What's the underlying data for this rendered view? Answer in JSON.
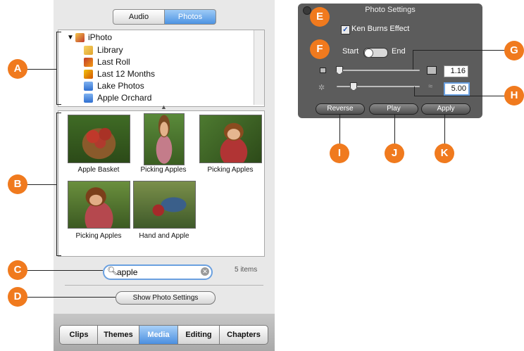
{
  "media_browser": {
    "segments": {
      "audio": "Audio",
      "photos": "Photos"
    },
    "source_list": {
      "root": "iPhoto",
      "items": [
        "Library",
        "Last Roll",
        "Last 12 Months",
        "Lake Photos",
        "Apple Orchard"
      ]
    },
    "photos": [
      {
        "caption": "Apple Basket"
      },
      {
        "caption": "Picking Apples"
      },
      {
        "caption": "Picking Apples"
      },
      {
        "caption": "Picking Apples"
      },
      {
        "caption": "Hand and Apple"
      }
    ],
    "search": {
      "value": "apple",
      "count_label": "5 items"
    },
    "show_settings_label": "Show Photo Settings",
    "tabs": [
      {
        "label": "Clips",
        "active": false
      },
      {
        "label": "Themes",
        "active": false
      },
      {
        "label": "Media",
        "active": true
      },
      {
        "label": "Editing",
        "active": false
      },
      {
        "label": "Chapters",
        "active": false
      }
    ]
  },
  "photo_settings": {
    "title": "Photo Settings",
    "ken_burns_label": "Ken Burns Effect",
    "ken_burns_checked": true,
    "start_label": "Start",
    "end_label": "End",
    "zoom_value": "1.16",
    "duration_value": "5.00",
    "buttons": {
      "reverse": "Reverse",
      "play": "Play",
      "apply": "Apply"
    }
  },
  "callouts": [
    "A",
    "B",
    "C",
    "D",
    "E",
    "F",
    "G",
    "H",
    "I",
    "J",
    "K"
  ],
  "colors": {
    "callout": "#f07a1e",
    "selected_blue": "#4b8fe0",
    "hud_bg": "#5c5c5c"
  }
}
